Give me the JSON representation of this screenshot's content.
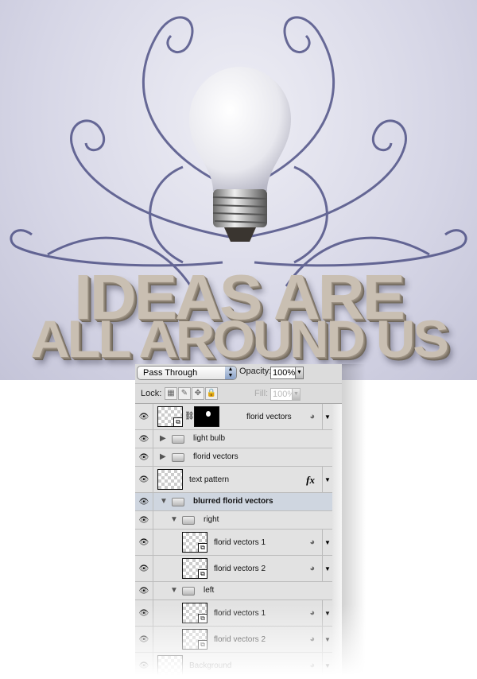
{
  "artwork": {
    "line1": "IDEAS ARE",
    "line2": "ALL AROUND US",
    "accent": "#3c3f78"
  },
  "options": {
    "blend_mode": "Pass Through",
    "opacity_label": "Opacity:",
    "opacity_value": "100%",
    "lock_label": "Lock:",
    "fill_label": "Fill:",
    "fill_value": "100%"
  },
  "layers": [
    {
      "name": "florid vectors",
      "type": "smart-mask",
      "depth": 0,
      "visible": true
    },
    {
      "name": "light bulb",
      "type": "group-collapsed",
      "depth": 0,
      "visible": true
    },
    {
      "name": "florid vectors",
      "type": "group-collapsed",
      "depth": 0,
      "visible": true
    },
    {
      "name": "text pattern",
      "type": "layer-fx",
      "depth": 0,
      "visible": true
    },
    {
      "name": "blurred florid vectors",
      "type": "group-open",
      "depth": 0,
      "visible": true,
      "selected": true
    },
    {
      "name": "right",
      "type": "group-open",
      "depth": 1,
      "visible": true
    },
    {
      "name": "florid vectors 1",
      "type": "smart",
      "depth": 2,
      "visible": true
    },
    {
      "name": "florid vectors 2",
      "type": "smart",
      "depth": 2,
      "visible": true
    },
    {
      "name": "left",
      "type": "group-open",
      "depth": 1,
      "visible": true
    },
    {
      "name": "florid vectors 1",
      "type": "smart",
      "depth": 2,
      "visible": true
    },
    {
      "name": "florid vectors 2",
      "type": "smart",
      "depth": 2,
      "visible": true
    },
    {
      "name": "Background",
      "type": "background",
      "depth": 0,
      "visible": true
    }
  ]
}
